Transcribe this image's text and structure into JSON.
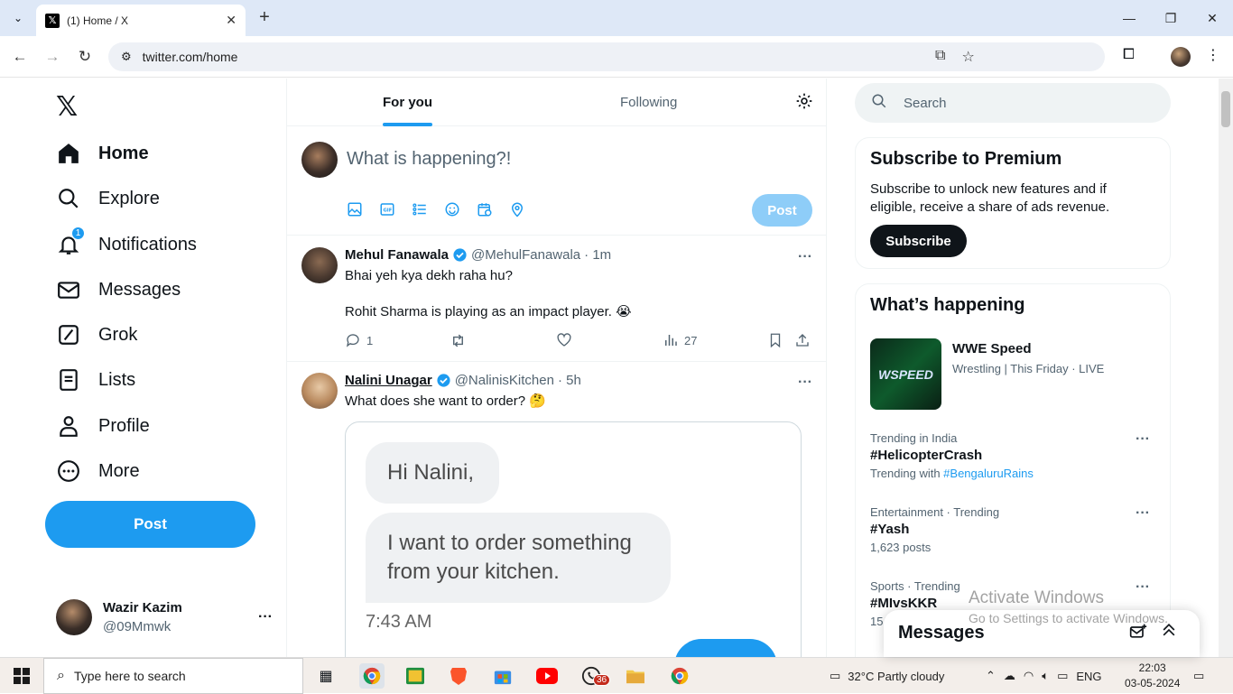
{
  "browser": {
    "tab_title": "(1) Home / X",
    "url": "twitter.com/home"
  },
  "nav": {
    "items": [
      {
        "label": "Home",
        "icon": "home-icon"
      },
      {
        "label": "Explore",
        "icon": "search-icon"
      },
      {
        "label": "Notifications",
        "icon": "bell-icon",
        "badge": "1"
      },
      {
        "label": "Messages",
        "icon": "envelope-icon"
      },
      {
        "label": "Grok",
        "icon": "grok-icon"
      },
      {
        "label": "Lists",
        "icon": "list-icon"
      },
      {
        "label": "Profile",
        "icon": "person-icon"
      },
      {
        "label": "More",
        "icon": "more-circle-icon"
      }
    ],
    "post_label": "Post",
    "user": {
      "name": "Wazir Kazim",
      "handle": "@09Mmwk"
    }
  },
  "feed": {
    "tabs": [
      "For you",
      "Following"
    ],
    "composer": {
      "placeholder": "What is happening?!",
      "post_label": "Post"
    },
    "tweets": [
      {
        "name": "Mehul Fanawala",
        "handle": "@MehulFanawala",
        "time": "· 1m",
        "line1": "Bhai yeh kya dekh raha hu?",
        "line2": "Rohit Sharma is playing as an impact player. 😭",
        "replies": "1",
        "views": "27"
      },
      {
        "name": "Nalini Unagar",
        "handle": "@NalinisKitchen",
        "time": "· 5h",
        "line1": "What does she want to order? 🤔",
        "card": {
          "bubble1": "Hi Nalini,",
          "bubble2": "I want to order something from your kitchen.",
          "time": "7:43 AM"
        }
      }
    ]
  },
  "sidebar": {
    "search_placeholder": "Search",
    "premium": {
      "title": "Subscribe to Premium",
      "text": "Subscribe to unlock new features and if eligible, receive a share of ads revenue.",
      "button": "Subscribe"
    },
    "happening": {
      "title": "What’s happening",
      "event": {
        "title": "WWE Speed",
        "sub": "Wrestling | This Friday · LIVE",
        "thumb": "WSPEED"
      },
      "trends": [
        {
          "category": "Trending in India",
          "title": "#HelicopterCrash",
          "sub_prefix": "Trending with ",
          "sub_link": "#BengaluruRains"
        },
        {
          "category": "Entertainment · Trending",
          "title": "#Yash",
          "sub": "1,623 posts"
        },
        {
          "category": "Sports · Trending",
          "title": "#MIvsKKR",
          "sub": "15"
        }
      ]
    },
    "messages_drawer": "Messages"
  },
  "watermark": {
    "line1": "Activate Windows",
    "line2": "Go to Settings to activate Windows."
  },
  "taskbar": {
    "search_placeholder": "Type here to search",
    "whatsapp_badge": "36",
    "weather": "32°C  Partly cloudy",
    "lang": "ENG",
    "time": "22:03",
    "date": "03-05-2024"
  }
}
